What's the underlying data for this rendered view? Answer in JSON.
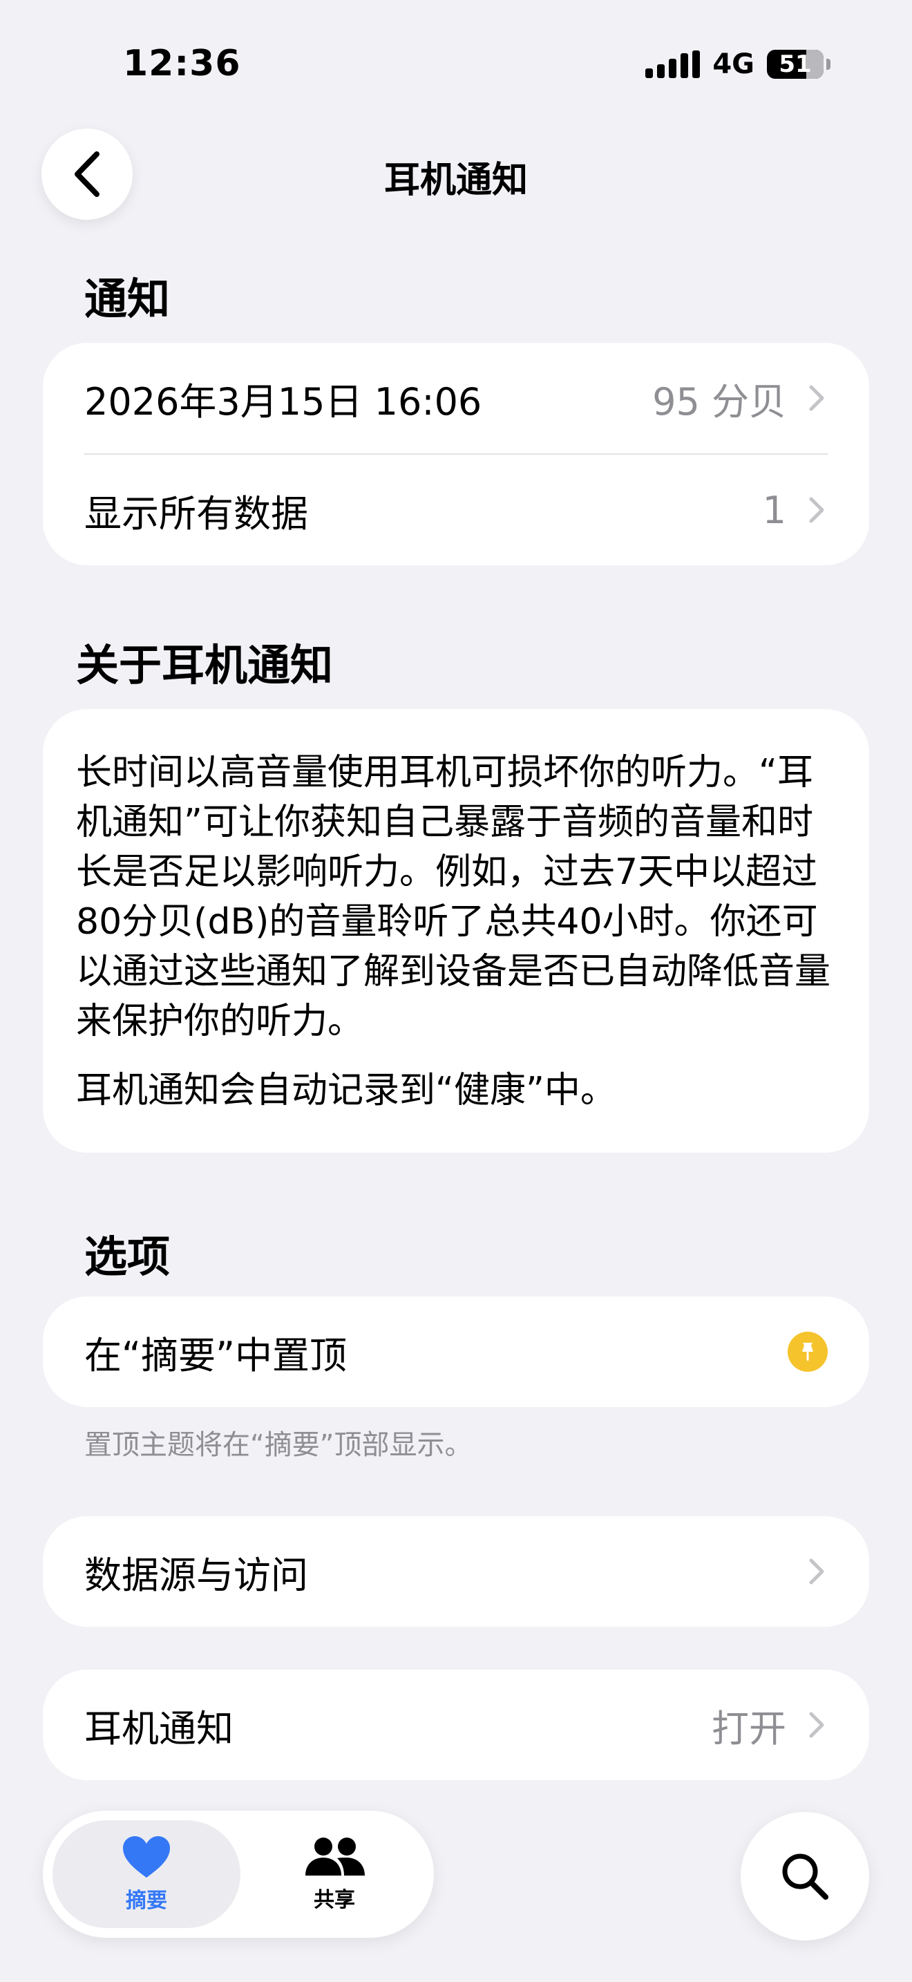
{
  "status_bar": {
    "time": "12:36",
    "network": "4G",
    "battery": "51"
  },
  "nav": {
    "title": "耳机通知"
  },
  "notifications": {
    "title": "通知",
    "rows": [
      {
        "label": "2026年3月15日   16:06",
        "value": "95 分贝"
      },
      {
        "label": "显示所有数据",
        "value": "1"
      }
    ]
  },
  "about": {
    "title": "关于耳机通知",
    "paragraph1": "长时间以高音量使用耳机可损坏你的听力。“耳机通知”可让你获知自己暴露于音频的音量和时长是否足以影响听力。例如，过去7天中以超过80分贝(dB)的音量聆听了总共40小时。你还可以通过这些通知了解到设备是否已自动降低音量来保护你的听力。",
    "paragraph2": "耳机通知会自动记录到“健康”中。"
  },
  "options": {
    "title": "选项",
    "pin_label": "在“摘要”中置顶",
    "pin_footnote": "置顶主题将在“摘要”顶部显示。",
    "data_sources_label": "数据源与访问",
    "headphone_notifications_label": "耳机通知",
    "headphone_notifications_value": "打开"
  },
  "tabbar": {
    "tabs": [
      {
        "label": "摘要",
        "icon": "heart-icon",
        "selected": true
      },
      {
        "label": "共享",
        "icon": "people-icon",
        "selected": false
      }
    ],
    "search_icon": "search-icon"
  },
  "colors": {
    "accent": "#3478f6",
    "pin": "#f5c32c",
    "secondary_text": "#8e8e93",
    "background": "#f1f1f6"
  }
}
